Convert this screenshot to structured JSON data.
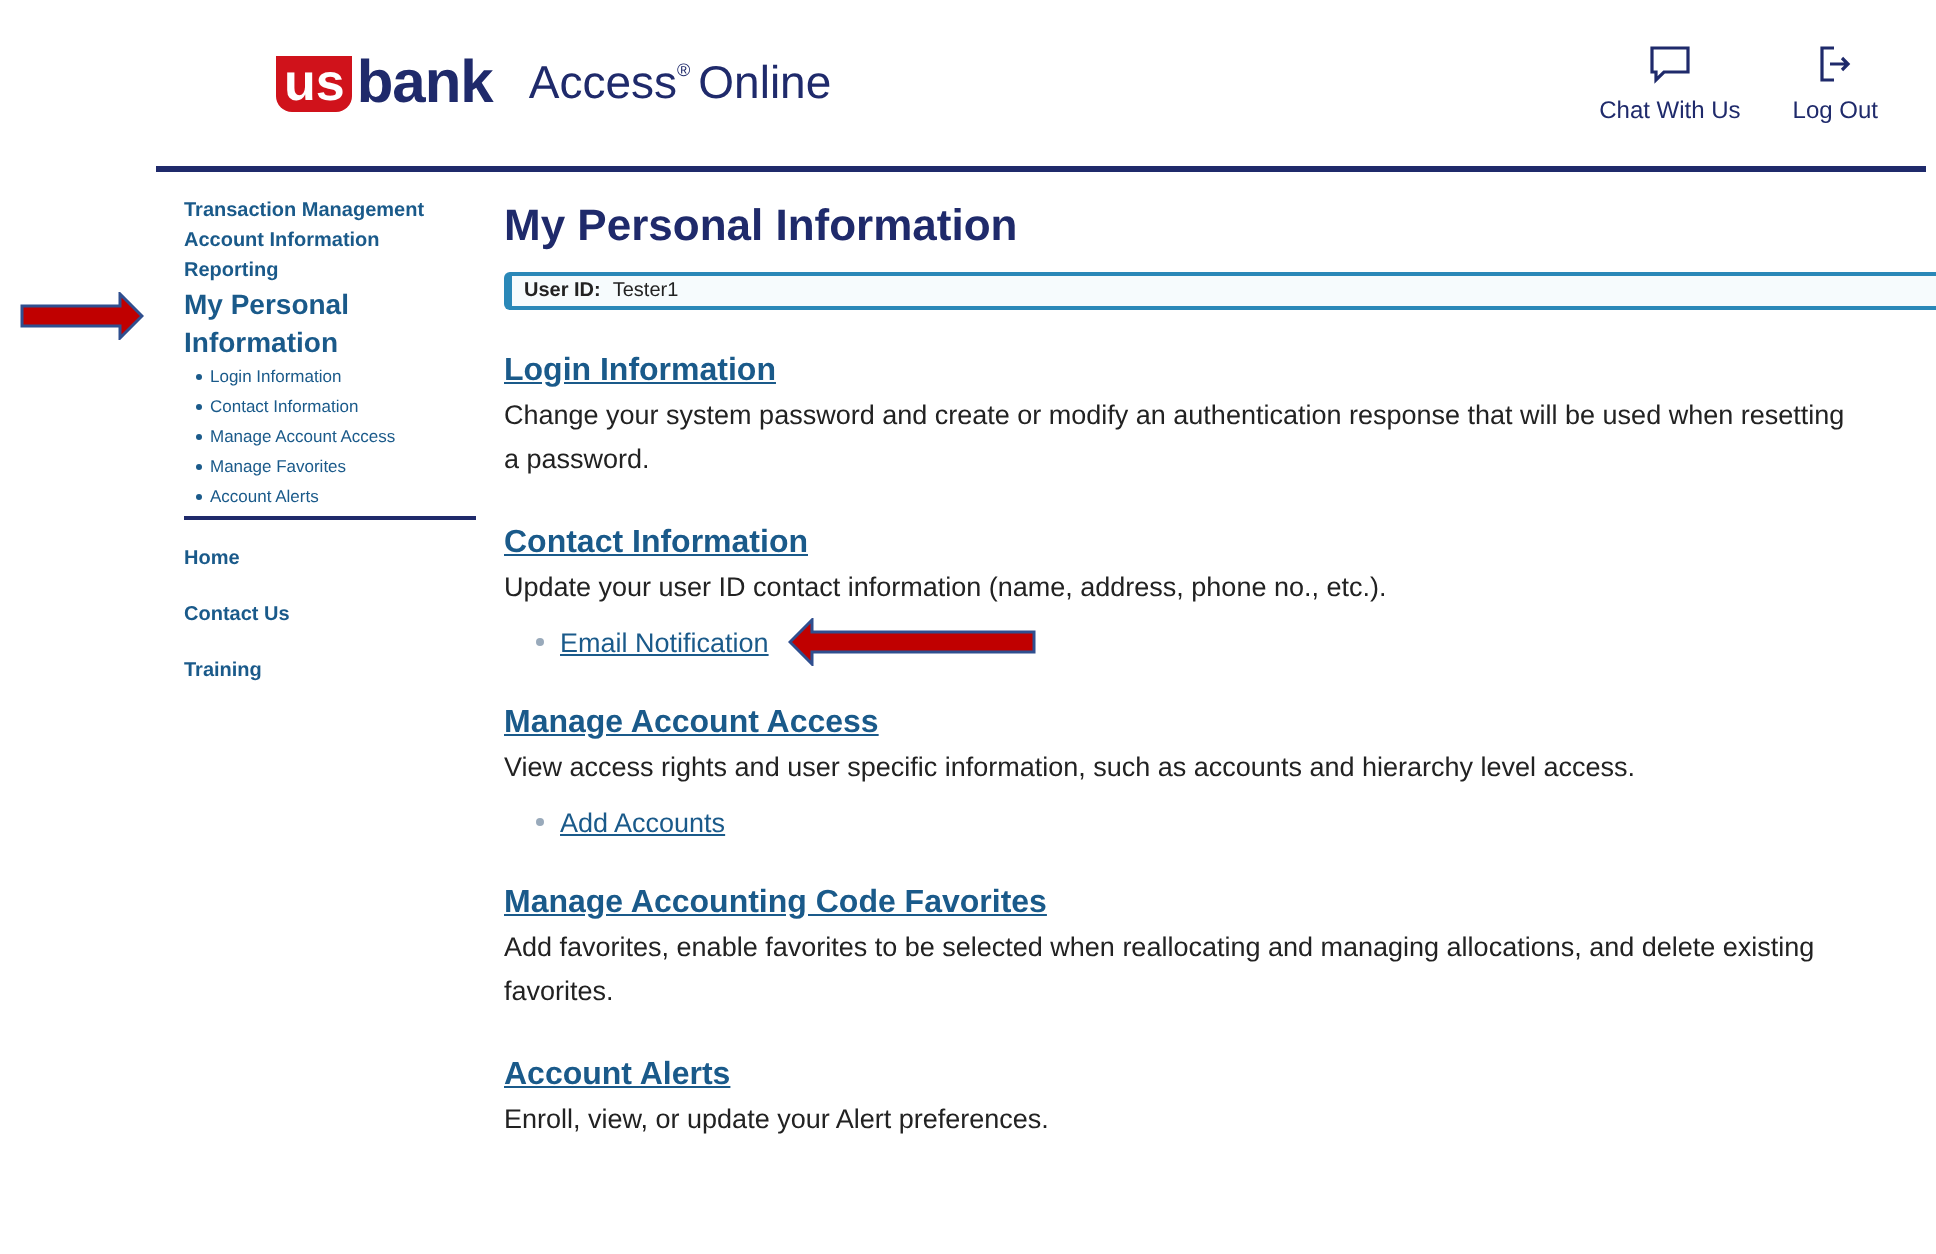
{
  "header": {
    "logo": {
      "mark": "us",
      "word": "bank"
    },
    "product": {
      "name": "Access",
      "reg": "®",
      "suffix": "Online"
    },
    "actions": [
      {
        "label": "Chat With Us",
        "kind": "chat"
      },
      {
        "label": "Log Out",
        "kind": "logout"
      }
    ]
  },
  "sidebar": {
    "items": [
      {
        "label": "Transaction Management",
        "selected": false,
        "arrow": false
      },
      {
        "label": "Account Information",
        "selected": false,
        "arrow": false
      },
      {
        "label": "Reporting",
        "selected": false,
        "arrow": false
      },
      {
        "label": "My Personal Information",
        "selected": true,
        "arrow": true,
        "children": [
          {
            "label": "Login Information"
          },
          {
            "label": "Contact Information"
          },
          {
            "label": "Manage Account Access"
          },
          {
            "label": "Manage Favorites"
          },
          {
            "label": "Account Alerts"
          }
        ]
      }
    ],
    "links": [
      {
        "label": "Home"
      },
      {
        "label": "Contact Us"
      },
      {
        "label": "Training"
      }
    ]
  },
  "main": {
    "title": "My Personal Information",
    "user_id": {
      "label": "User ID:",
      "value": "Tester1"
    },
    "sections": [
      {
        "title": "Login Information",
        "description": "Change your system password and create or modify an authentication response that will be used when resetting a password."
      },
      {
        "title": "Contact Information",
        "description": "Update your user ID contact information (name, address, phone no., etc.).",
        "links": [
          {
            "label": "Email Notification",
            "arrow": true
          }
        ]
      },
      {
        "title": "Manage Account Access",
        "description": "View access rights and user specific information, such as accounts and hierarchy level access.",
        "links": [
          {
            "label": "Add Accounts",
            "arrow": false
          }
        ]
      },
      {
        "title": "Manage Accounting Code Favorites",
        "description": "Add favorites, enable favorites to be selected when reallocating and managing allocations, and delete existing favorites."
      },
      {
        "title": "Account Alerts",
        "description": "Enroll, view, or update your Alert preferences."
      }
    ]
  }
}
